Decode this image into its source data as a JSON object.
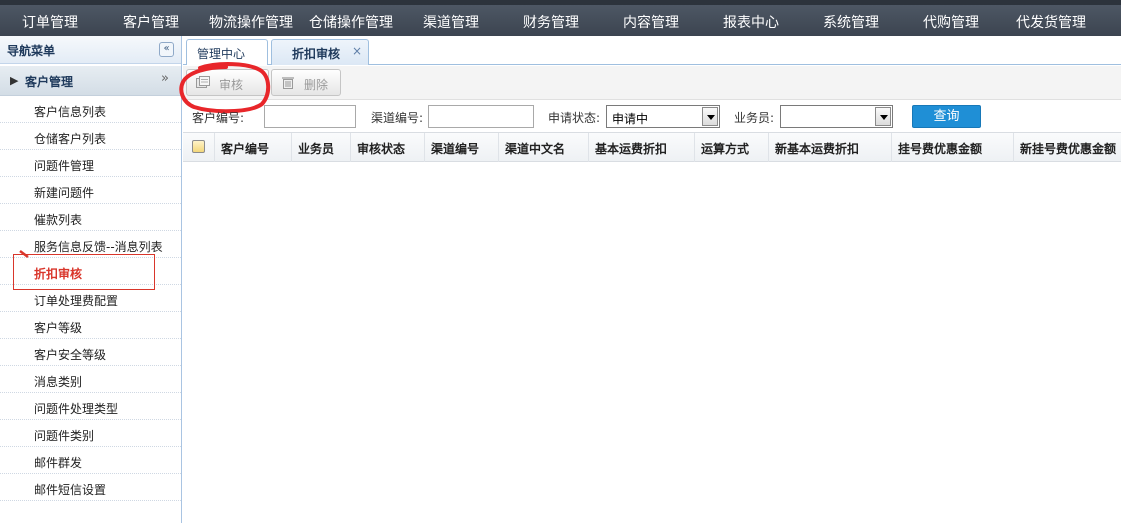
{
  "topnav": {
    "items": [
      "订单管理",
      "客户管理",
      "物流操作管理",
      "仓储操作管理",
      "渠道管理",
      "财务管理",
      "内容管理",
      "报表中心",
      "系统管理",
      "代购管理",
      "代发货管理"
    ]
  },
  "sidebar": {
    "title": "导航菜单",
    "collapse_icon": "double-chevron-left-icon",
    "group": {
      "label": "客户管理",
      "icon": "triangle-right-icon",
      "toggle_icon": "double-chevron-down-icon"
    },
    "items": [
      {
        "label": "客户信息列表"
      },
      {
        "label": "仓储客户列表"
      },
      {
        "label": "问题件管理"
      },
      {
        "label": "新建问题件"
      },
      {
        "label": "催款列表"
      },
      {
        "label": "服务信息反馈--消息列表"
      },
      {
        "label": "折扣审核",
        "active": true
      },
      {
        "label": "订单处理费配置"
      },
      {
        "label": "客户等级"
      },
      {
        "label": "客户安全等级"
      },
      {
        "label": "消息类别"
      },
      {
        "label": "问题件处理类型"
      },
      {
        "label": "问题件类别"
      },
      {
        "label": "邮件群发"
      },
      {
        "label": "邮件短信设置"
      }
    ],
    "active_color": "#d9362b"
  },
  "tabs": {
    "home": "管理中心",
    "current": "折扣审核",
    "close": "×"
  },
  "toolbar": {
    "audit_label": "审核",
    "delete_label": "删除",
    "annotation_color": "#e8262a"
  },
  "search": {
    "customer_code_label": "客户编号:",
    "customer_code_value": "",
    "channel_code_label": "渠道编号:",
    "channel_code_value": "",
    "status_label": "申请状态:",
    "status_value": "申请中",
    "salesman_label": "业务员:",
    "salesman_value": "",
    "query_label": "查询",
    "query_color": "#1f8fd6"
  },
  "table": {
    "columns": [
      "客户编号",
      "业务员",
      "审核状态",
      "渠道编号",
      "渠道中文名",
      "基本运费折扣",
      "运算方式",
      "新基本运费折扣",
      "挂号费优惠金额",
      "新挂号费优惠金额"
    ],
    "rows": []
  }
}
